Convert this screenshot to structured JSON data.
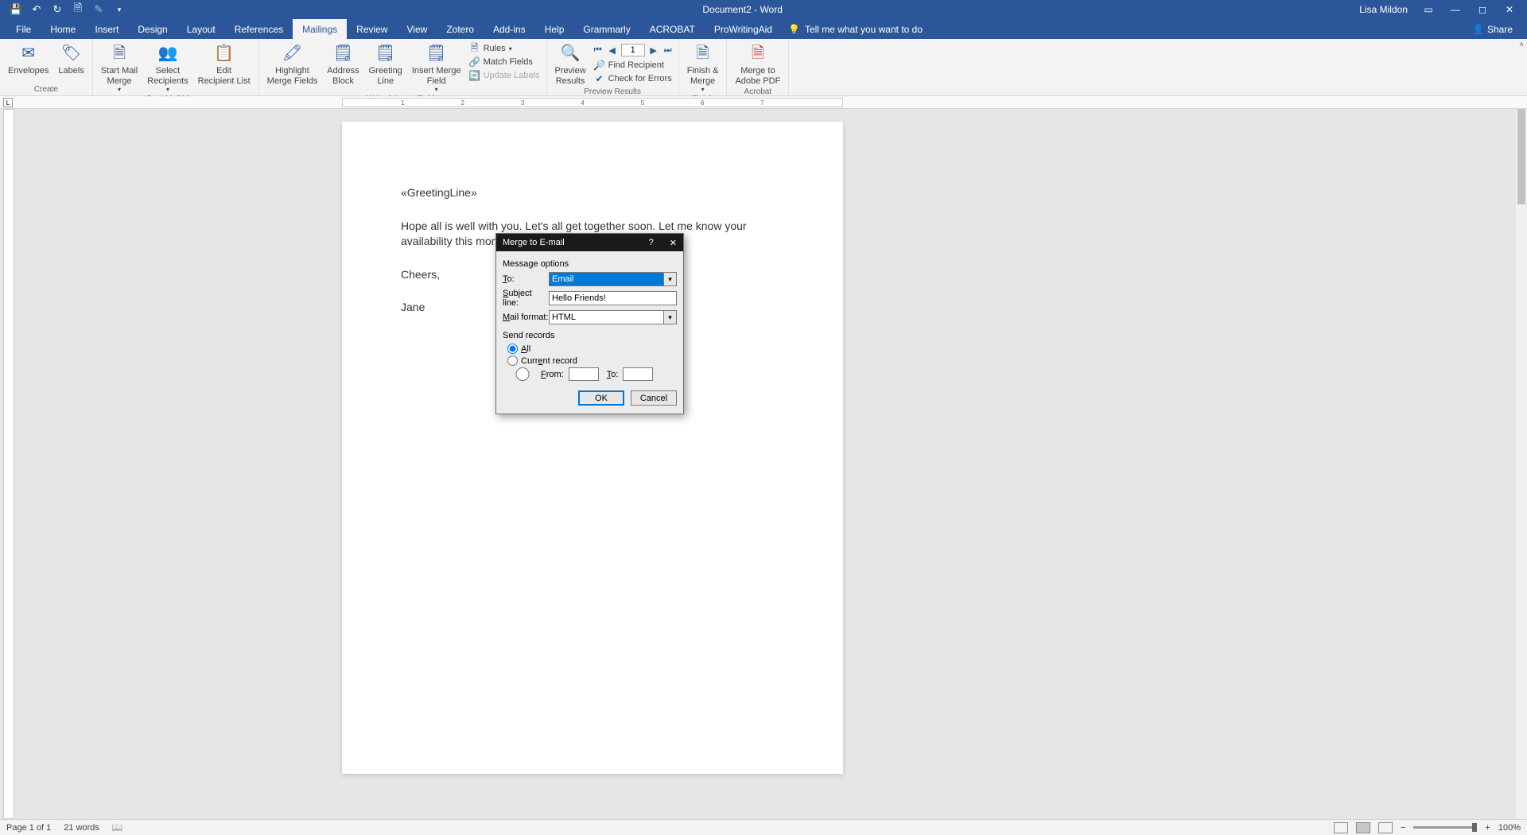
{
  "title": {
    "doc": "Document2",
    "sep": "  -  ",
    "app": "Word"
  },
  "user": "Lisa Mildon",
  "share_label": "Share",
  "tabs": [
    "File",
    "Home",
    "Insert",
    "Design",
    "Layout",
    "References",
    "Mailings",
    "Review",
    "View",
    "Zotero",
    "Add-ins",
    "Help",
    "Grammarly",
    "ACROBAT",
    "ProWritingAid"
  ],
  "active_tab": "Mailings",
  "tellme": "Tell me what you want to do",
  "ribbon": {
    "groups": {
      "create": {
        "label": "Create",
        "envelopes": "Envelopes",
        "labels": "Labels"
      },
      "start": {
        "label": "Start Mail Merge",
        "start_mail_merge": "Start Mail\nMerge",
        "select_recipients": "Select\nRecipients",
        "edit_recipient_list": "Edit\nRecipient List"
      },
      "write": {
        "label": "Write & Insert Fields",
        "highlight": "Highlight\nMerge Fields",
        "address": "Address\nBlock",
        "greeting": "Greeting\nLine",
        "insert_field": "Insert Merge\nField",
        "rules": "Rules",
        "match": "Match Fields",
        "update": "Update Labels"
      },
      "preview": {
        "label": "Preview Results",
        "preview_results": "Preview\nResults",
        "record_value": "1",
        "find": "Find Recipient",
        "check": "Check for Errors"
      },
      "finish": {
        "label": "Finish",
        "finish_merge": "Finish &\nMerge"
      },
      "acrobat": {
        "label": "Acrobat",
        "merge_pdf": "Merge to\nAdobe PDF"
      }
    }
  },
  "document": {
    "lines": [
      "«GreetingLine»",
      "Hope all is well with you. Let's all get together soon. Let me know your availability this month.",
      "Cheers,",
      "Jane"
    ]
  },
  "dialog": {
    "title": "Merge to E-mail",
    "section_message": "Message options",
    "to_label": "To:",
    "to_value": "Email",
    "subject_label": "Subject line:",
    "subject_value": "Hello Friends!",
    "format_label": "Mail format:",
    "format_value": "HTML",
    "section_send": "Send records",
    "opt_all": "All",
    "opt_current": "Current record",
    "opt_from": "From:",
    "opt_to": "To:",
    "ok": "OK",
    "cancel": "Cancel"
  },
  "status": {
    "page": "Page 1 of 1",
    "words": "21 words",
    "zoom": "100%"
  },
  "ruler_marks": [
    "1",
    "2",
    "3",
    "4",
    "5",
    "6",
    "7"
  ]
}
